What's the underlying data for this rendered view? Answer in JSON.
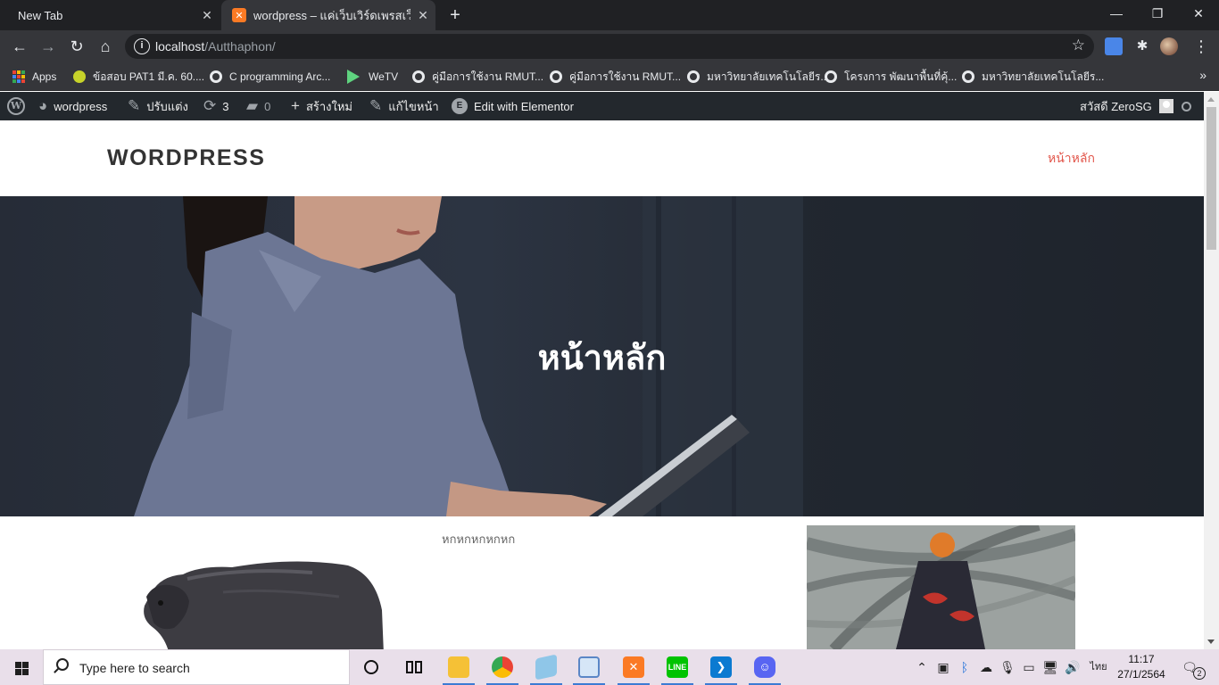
{
  "browser": {
    "tabs": [
      {
        "title": "New Tab",
        "active": false
      },
      {
        "title": "wordpress – แค่เว็บเวิร์ดเพรสเว็บหนึ่ง",
        "active": true
      }
    ],
    "close_glyph": "✕",
    "new_tab_glyph": "+",
    "window_controls": {
      "minimize": "—",
      "restore": "❐",
      "close": "✕"
    },
    "url": {
      "host": "localhost",
      "path": "/Autthaphon/"
    },
    "nav": {
      "back": "←",
      "forward": "→",
      "reload": "↻",
      "home": "⌂"
    },
    "star_glyph": "☆",
    "menu_glyph": "⋮",
    "bookmarks": [
      {
        "label": "Apps",
        "icon": "apps-grid-icon"
      },
      {
        "label": "ข้อสอบ PAT1 มี.ค. 60....",
        "icon": "pat-favicon"
      },
      {
        "label": "C programming Arc...",
        "icon": "globe-icon"
      },
      {
        "label": "WeTV",
        "icon": "wetv-icon"
      },
      {
        "label": "คู่มือการใช้งาน RMUT...",
        "icon": "globe-icon"
      },
      {
        "label": "คู่มือการใช้งาน RMUT...",
        "icon": "globe-icon"
      },
      {
        "label": "มหาวิทยาลัยเทคโนโลยีร...",
        "icon": "globe-icon"
      },
      {
        "label": "โครงการ พัฒนาพื้นที่คุ้...",
        "icon": "globe-icon"
      },
      {
        "label": "มหาวิทยาลัยเทคโนโลยีร...",
        "icon": "globe-icon"
      }
    ],
    "bookmarks_more": "»"
  },
  "wp_admin_bar": {
    "site_name": "wordpress",
    "customize": "ปรับแต่ง",
    "updates_count": "3",
    "comments_count": "0",
    "new": "สร้างใหม่",
    "edit": "แก้ไขหน้า",
    "elementor": "Edit with Elementor",
    "greeting": "สวัสดี ZeroSG"
  },
  "site": {
    "title": "WORDPRESS",
    "nav_home": "หน้าหลัก"
  },
  "hero": {
    "title": "หน้าหลัก"
  },
  "content": {
    "text": "หกหกหกหกหก"
  },
  "taskbar": {
    "search_placeholder": "Type here to search",
    "language": "ไทย",
    "time": "11:17",
    "date": "27/1/2564",
    "notifications_count": "2"
  },
  "colors": {
    "accent": "#e2574c",
    "wp_bar": "#23282d",
    "chrome_dark": "#202124",
    "chrome_toolbar": "#35363a"
  }
}
